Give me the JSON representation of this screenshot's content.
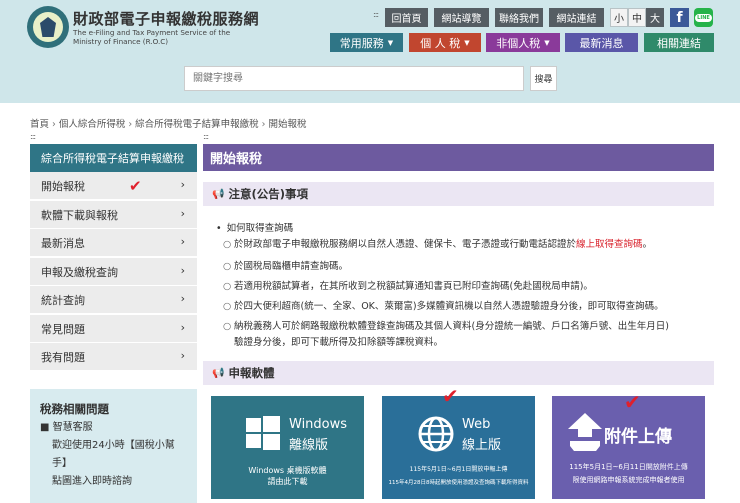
{
  "header": {
    "title": "財政部電子申報繳稅服務網",
    "subtitle": "The e-Filing and Tax Payment Service of the Ministry of Finance (R.O.C)"
  },
  "toolbar": {
    "links": [
      "回首頁",
      "網站導覽",
      "聯絡我們",
      "網站連結"
    ],
    "font_sizes": [
      "小",
      "中",
      "大"
    ],
    "facebook": "f",
    "line": "LINE"
  },
  "nav": {
    "items": [
      {
        "label": "常用服務",
        "has_menu": true,
        "color": "#2f7586"
      },
      {
        "label": "個 人 稅",
        "has_menu": true,
        "color": "#c1462f"
      },
      {
        "label": "非個人稅",
        "has_menu": true,
        "color": "#8a3a9a"
      },
      {
        "label": "最新消息",
        "has_menu": false,
        "color": "#5a57a8"
      },
      {
        "label": "相關連結",
        "has_menu": false,
        "color": "#2f8a6a"
      }
    ]
  },
  "search": {
    "placeholder": "關鍵字搜尋",
    "button": "搜尋"
  },
  "breadcrumb": [
    "首頁",
    "個人綜合所得稅",
    "綜合所得稅電子結算申報繳稅",
    "開始報稅"
  ],
  "sidebar": {
    "heading": "綜合所得稅電子結算申報繳稅",
    "items": [
      {
        "label": "開始報稅",
        "active": true
      },
      {
        "label": "軟體下載與報稅"
      },
      {
        "label": "最新消息"
      },
      {
        "label": "申報及繳稅查詢"
      },
      {
        "label": "統計查詢"
      },
      {
        "label": "常見問題"
      },
      {
        "label": "我有問題"
      }
    ],
    "related": {
      "title": "稅務相關問題",
      "service_label": "■ 智慧客服",
      "line1": "歡迎使用24小時【國稅小幫",
      "line2": "手】",
      "line3": "點圖進入即時諮詢"
    }
  },
  "main": {
    "title": "開始報稅",
    "notice_heading": "注意(公告)事項",
    "how_to_get": "如何取得查詢碼",
    "bullets": {
      "b1_text": "於財政部電子申報繳稅服務網以自然人憑證、健保卡、電子憑證或行動電話認證於",
      "b1_link": "線上取得查詢碼",
      "b1_end": "。",
      "b2": "於國稅局臨櫃申請查詢碼。",
      "b3": "若適用稅額試算者，在其所收到之稅額試算通知書頁已附印查詢碼(免赴國稅局申請)。",
      "b4": "於四大便利超商(統一、全家、OK、萊爾富)多媒體資訊機以自然人憑證驗證身分後，即可取得查詢碼。",
      "b5a": "納稅義務人可於網路報繳稅軟體登錄查詢碼及其個人資料(身分證統一編號、戶口名簿戶號、出生年月日)",
      "b5b": "驗證身分後，即可下載所得及扣除額等課稅資料。"
    },
    "software_heading": "申報軟體",
    "tiles": [
      {
        "title1": "Windows",
        "title2": "離線版",
        "foot1": "Windows 桌機版軟體",
        "foot2": "請由此下載",
        "color": "#2f7586"
      },
      {
        "title1": "Web",
        "title2": "線上版",
        "foot1": "115年5月1日~6月1日開放申報上傳",
        "foot2": "115年4月28日8時起開放使用憑證及查詢碼下載所得資料",
        "color": "#2a6f99"
      },
      {
        "title1": "附件上傳",
        "title2": "",
        "foot1": "115年5月1日~6月11日開放附件上傳",
        "foot2": "限使用網路申報系統完成申報者使用",
        "color": "#6a5fae"
      }
    ]
  }
}
